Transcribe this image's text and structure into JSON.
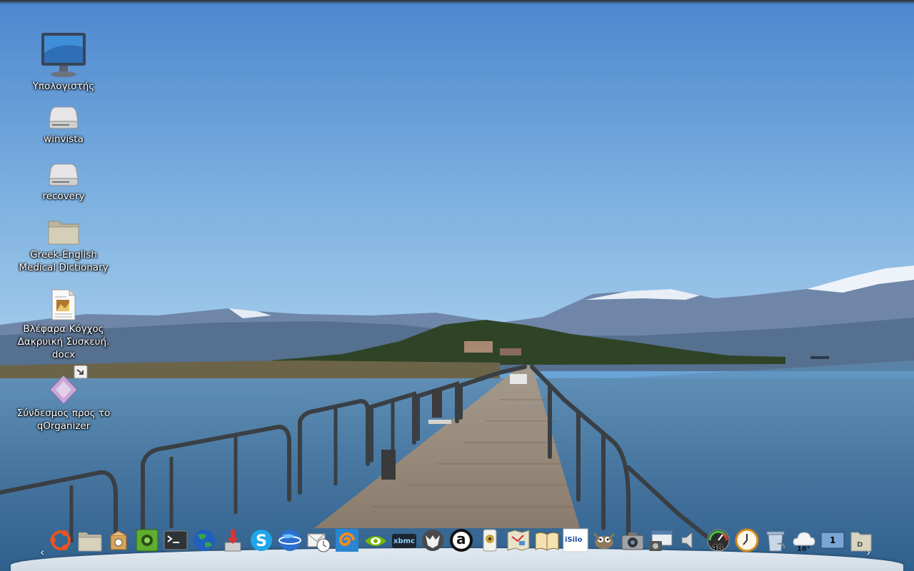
{
  "desktop": {
    "icons": [
      {
        "label": "Υπολογιστής",
        "icon": "computer-icon"
      },
      {
        "label": "winvista",
        "icon": "drive-icon"
      },
      {
        "label": "recovery",
        "icon": "drive-icon"
      },
      {
        "label": "Greek-English\nMedical Dictionary",
        "icon": "folder-icon"
      },
      {
        "label": "Βλέφαρα Κόγχος\nΔακρυική Συσκευή.\ndocx",
        "icon": "document-icon"
      },
      {
        "label": "Σύνδεσμος προς το\nqOrganizer",
        "icon": "link-icon"
      }
    ]
  },
  "dock": {
    "left_arrow": "‹",
    "right_arrow": "›",
    "items": [
      {
        "name": "ubuntu-menu",
        "icon": "ubuntu-icon"
      },
      {
        "name": "folder",
        "icon": "folder-icon"
      },
      {
        "name": "software-center",
        "icon": "package-icon"
      },
      {
        "name": "synaptic",
        "icon": "green-box-icon"
      },
      {
        "name": "terminal",
        "icon": "terminal-icon"
      },
      {
        "name": "browser",
        "icon": "globe-icon"
      },
      {
        "name": "torrent",
        "icon": "download-icon"
      },
      {
        "name": "skype",
        "icon": "skype-icon"
      },
      {
        "name": "google-earth",
        "icon": "earth-icon"
      },
      {
        "name": "mail-scheduler",
        "icon": "mail-clock-icon"
      },
      {
        "name": "blender",
        "icon": "spiral-icon"
      },
      {
        "name": "nvidia-settings",
        "icon": "nvidia-icon"
      },
      {
        "name": "xbmc",
        "icon": "xbmc-icon",
        "text": "xbmc"
      },
      {
        "name": "wolf-app",
        "icon": "wolf-icon"
      },
      {
        "name": "anki",
        "icon": "anki-icon",
        "text": "a"
      },
      {
        "name": "speaker-app",
        "icon": "speaker-icon"
      },
      {
        "name": "maps",
        "icon": "map-icon"
      },
      {
        "name": "dictionary",
        "icon": "book-icon"
      },
      {
        "name": "isilo",
        "icon": "isilo-icon",
        "text": "iSilo"
      },
      {
        "name": "gimp",
        "icon": "gimp-icon"
      },
      {
        "name": "camera",
        "icon": "camera-icon"
      },
      {
        "name": "screenshot",
        "icon": "screenshot-icon"
      },
      {
        "name": "volume",
        "icon": "volume-icon"
      },
      {
        "name": "system-monitor",
        "icon": "gauge-icon",
        "text": "48"
      },
      {
        "name": "clock",
        "icon": "clock-icon"
      },
      {
        "name": "trash",
        "icon": "trash-icon"
      },
      {
        "name": "weather",
        "icon": "weather-icon",
        "text": "16°"
      },
      {
        "name": "workspace-switcher",
        "icon": "workspace-icon",
        "text": "1"
      },
      {
        "name": "docs-folder",
        "icon": "docs-folder-icon",
        "text": "D"
      }
    ]
  },
  "colors": {
    "sky_top": "#4f8ad0",
    "sky_bottom": "#8fbde6",
    "water": "#4a7fa8",
    "dock_shelf": "#e8edf2"
  }
}
